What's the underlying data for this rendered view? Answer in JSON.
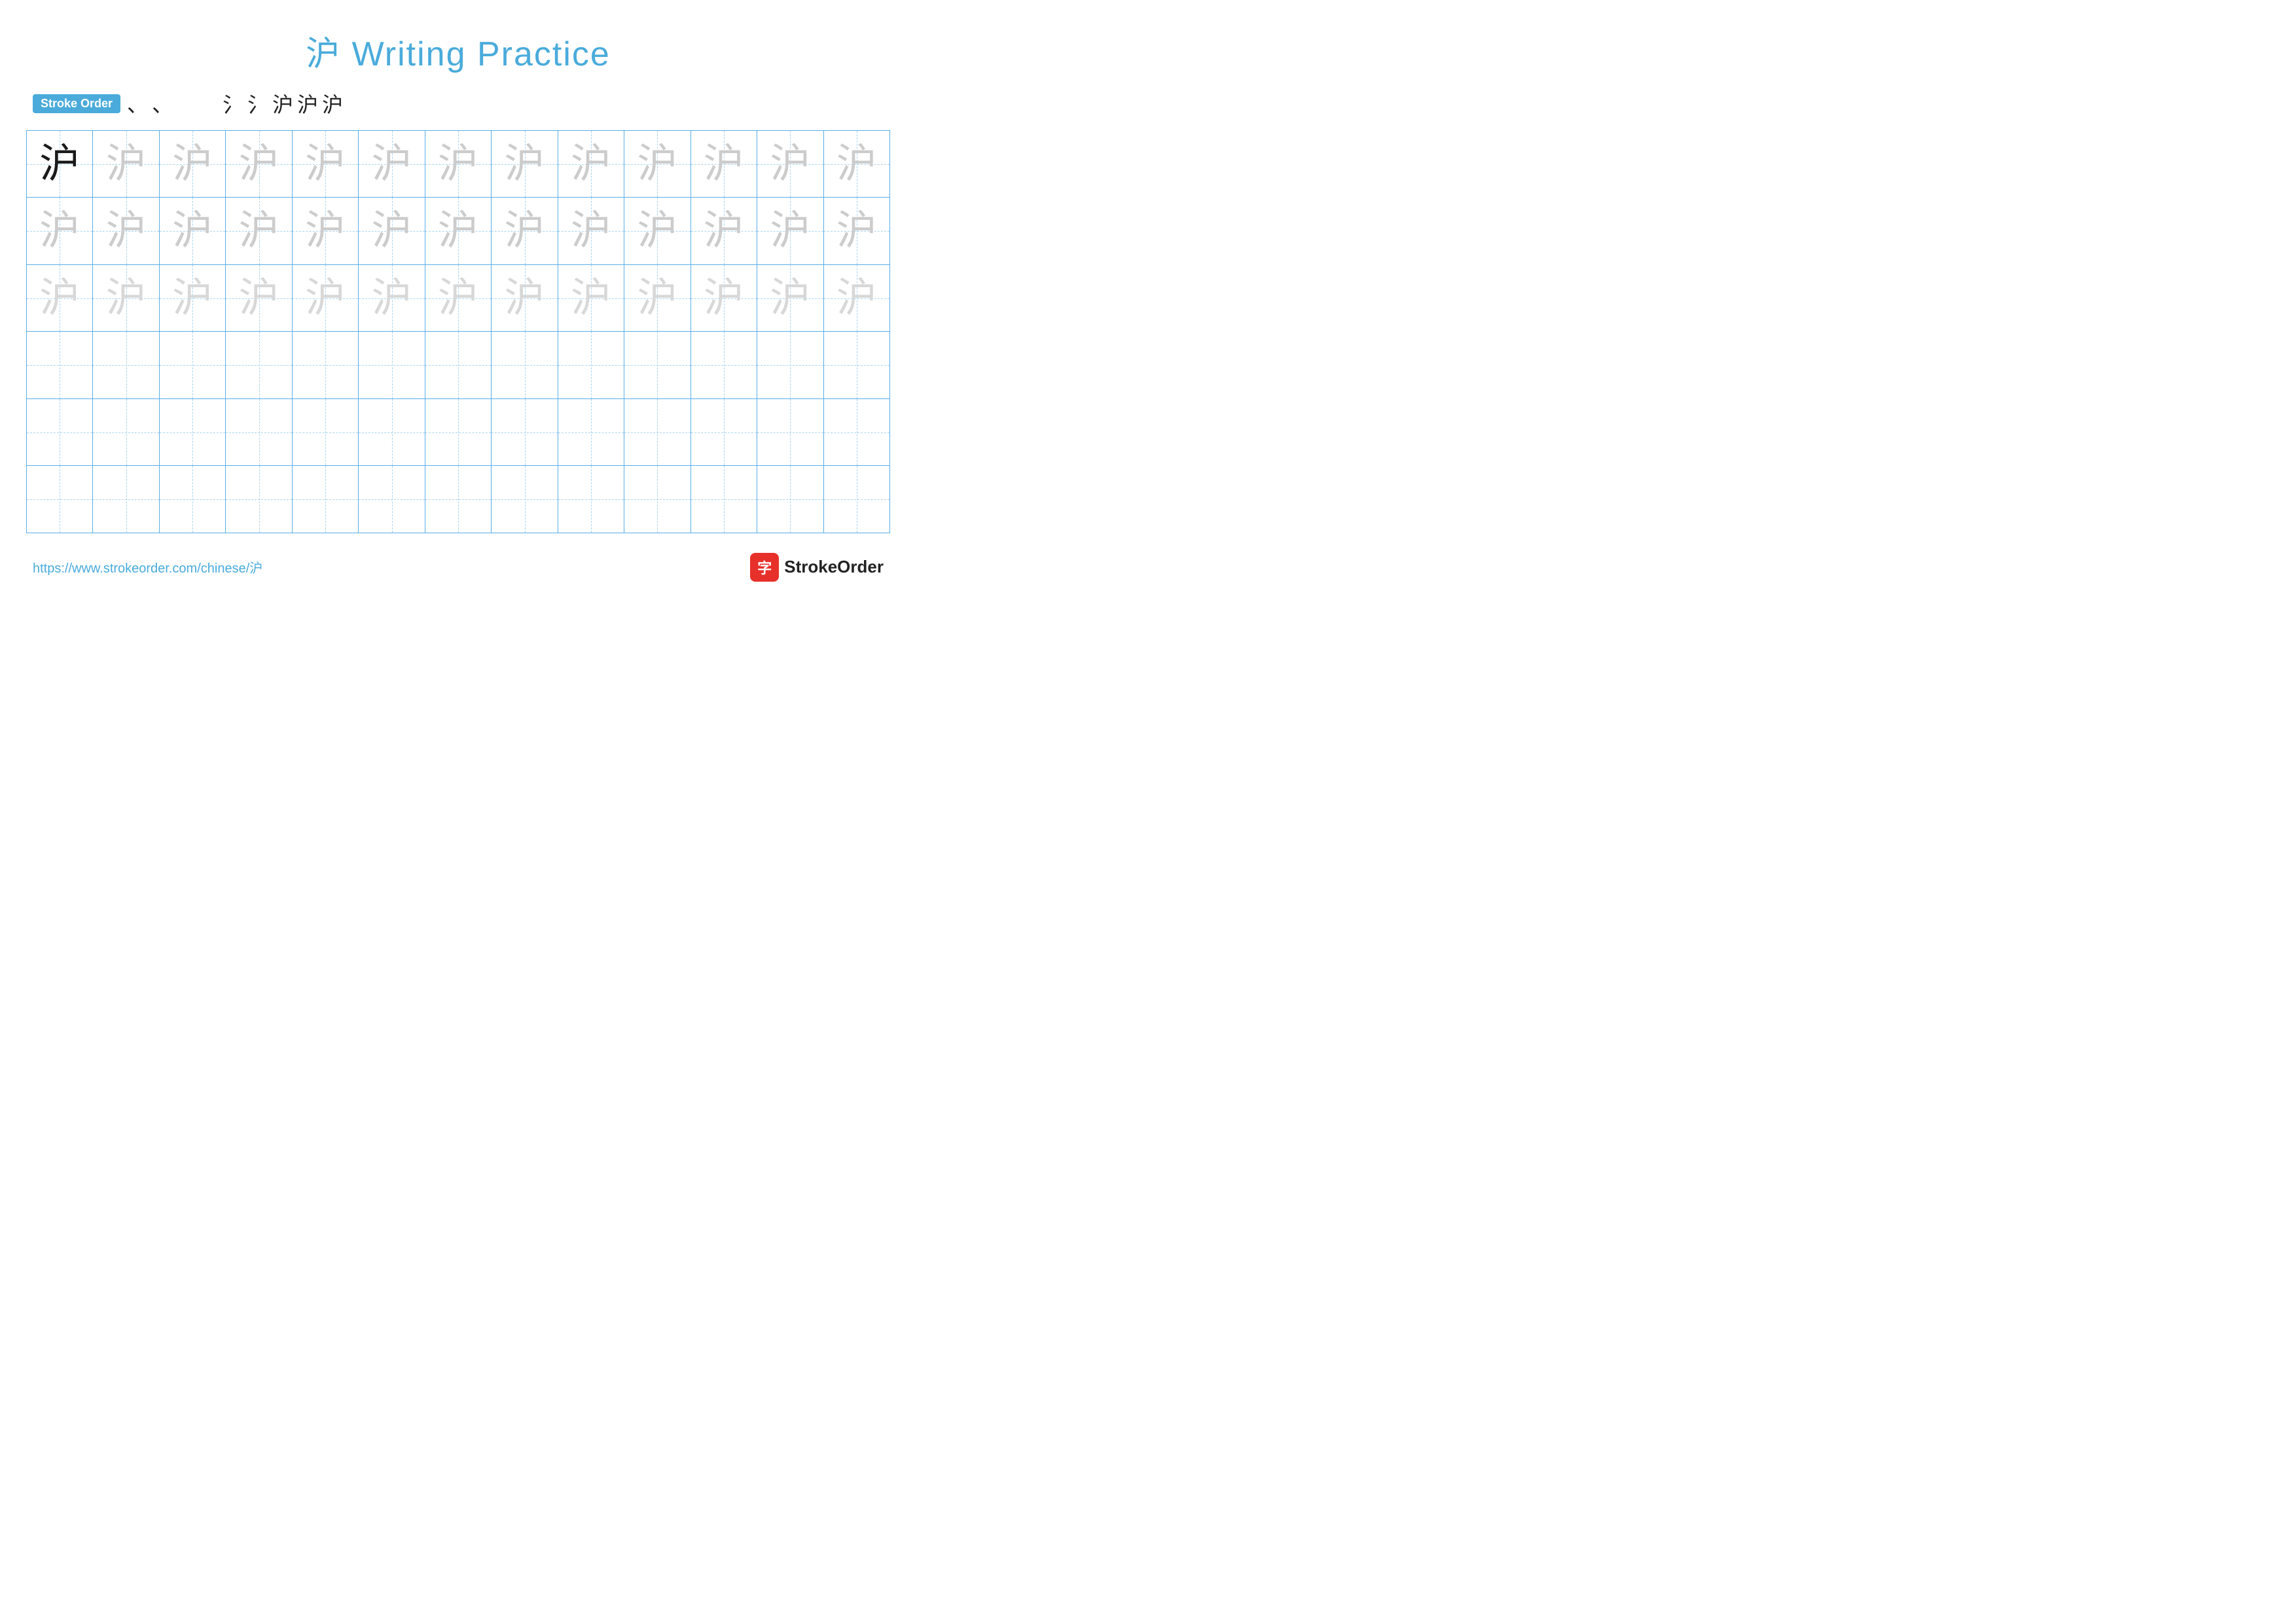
{
  "title": {
    "text": "沪 Writing Practice",
    "color": "#4aabdb"
  },
  "stroke_order": {
    "badge": "Stroke Order",
    "chars": [
      "、",
      "、",
      "𝄋",
      "氵",
      "氵",
      "沪",
      "沪",
      "沪"
    ]
  },
  "grid": {
    "rows": 6,
    "cols": 13,
    "character": "沪"
  },
  "footer": {
    "url": "https://www.strokeorder.com/chinese/沪",
    "logo_char": "字",
    "logo_text": "StrokeOrder"
  }
}
